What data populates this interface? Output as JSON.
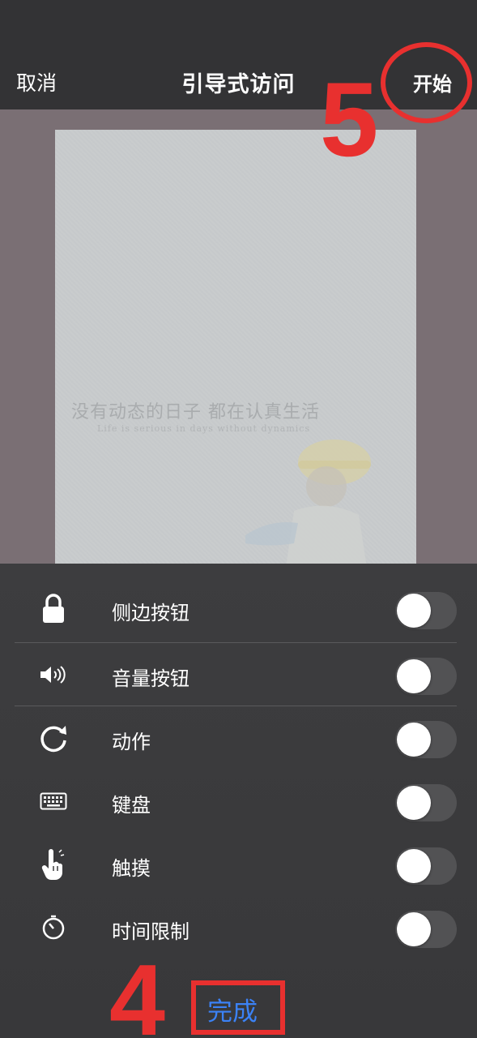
{
  "header": {
    "cancel_label": "取消",
    "title": "引导式访问",
    "start_label": "开始"
  },
  "preview": {
    "quote_cn": "没有动态的日子 都在认真生活",
    "quote_en": "Life is serious in days without dynamics"
  },
  "settings": {
    "rows": [
      {
        "label": "侧边按钮",
        "icon": "lock-icon",
        "enabled": false
      },
      {
        "label": "音量按钮",
        "icon": "speaker-icon",
        "enabled": false
      },
      {
        "label": "动作",
        "icon": "rotate-icon",
        "enabled": false
      },
      {
        "label": "键盘",
        "icon": "keyboard-icon",
        "enabled": false
      },
      {
        "label": "触摸",
        "icon": "touch-hand-icon",
        "enabled": false
      },
      {
        "label": "时间限制",
        "icon": "timer-icon",
        "enabled": false
      }
    ]
  },
  "footer": {
    "done_label": "完成"
  },
  "annotations": {
    "step_4": "4",
    "step_5": "5",
    "color": "#e8302f"
  },
  "colors": {
    "accent": "#3b82f6",
    "panel_bg": "#3d3d3f",
    "toggle_off": "#525254"
  }
}
